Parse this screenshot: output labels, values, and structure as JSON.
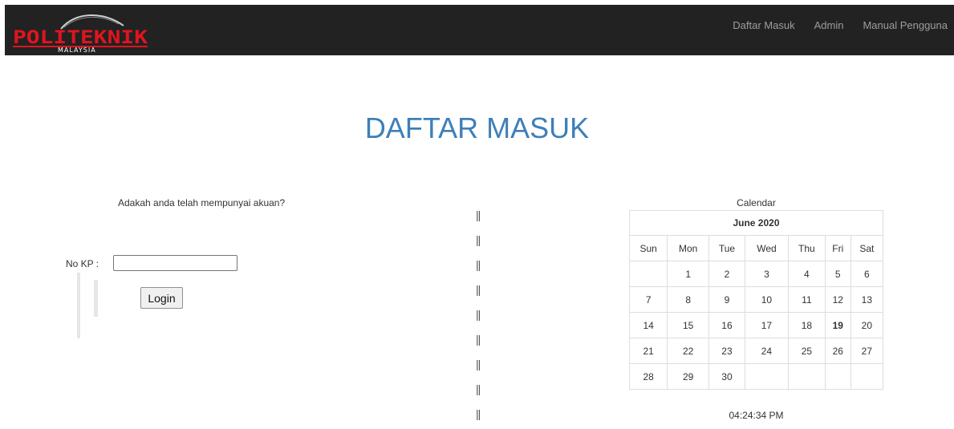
{
  "navbar": {
    "logo_text": "POLITEKNIK",
    "logo_subtext": "MALAYSIA",
    "links": [
      "Daftar Masuk",
      "Admin",
      "Manual Pengguna"
    ]
  },
  "page": {
    "title": "DAFTAR MASUK"
  },
  "login": {
    "question": "Adakah anda telah mempunyai akuan?",
    "nokp_label": "No KP :",
    "nokp_value": "",
    "button_label": "Login"
  },
  "separator": [
    "||",
    "||",
    "||",
    "||",
    "||",
    "||",
    "||",
    "||",
    "||"
  ],
  "calendar": {
    "caption": "Calendar",
    "month": "June 2020",
    "weekdays": [
      "Sun",
      "Mon",
      "Tue",
      "Wed",
      "Thu",
      "Fri",
      "Sat"
    ],
    "weeks": [
      [
        "",
        "1",
        "2",
        "3",
        "4",
        "5",
        "6"
      ],
      [
        "7",
        "8",
        "9",
        "10",
        "11",
        "12",
        "13"
      ],
      [
        "14",
        "15",
        "16",
        "17",
        "18",
        "19",
        "20"
      ],
      [
        "21",
        "22",
        "23",
        "24",
        "25",
        "26",
        "27"
      ],
      [
        "28",
        "29",
        "30",
        "",
        "",
        "",
        ""
      ]
    ],
    "highlighted_day": "19"
  },
  "clock": "04:24:34 PM",
  "colors": {
    "navbar_bg": "#222222",
    "title": "#3e7fb8",
    "logo_red": "#e0141e"
  }
}
